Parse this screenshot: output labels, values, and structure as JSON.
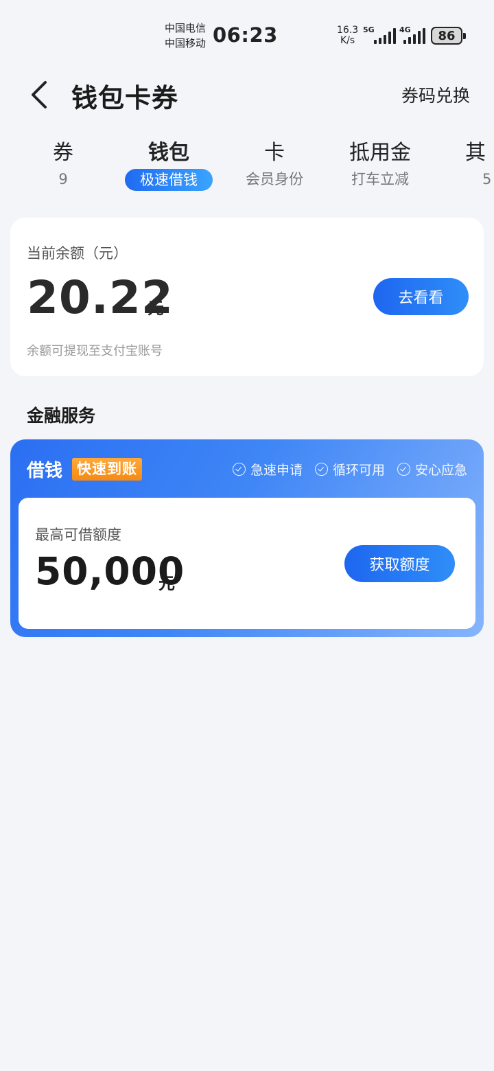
{
  "status_bar": {
    "carrier1": "中国电信",
    "carrier2": "中国移动",
    "time": "06:23",
    "net_speed_value": "16.3",
    "net_speed_unit": "K/s",
    "sim1_network": "5G",
    "sim2_network": "4G",
    "battery": "86"
  },
  "header": {
    "title": "钱包卡券",
    "action": "券码兑换"
  },
  "tabs": [
    {
      "title": "券",
      "sub": "9"
    },
    {
      "title": "钱包",
      "sub": "极速借钱"
    },
    {
      "title": "卡",
      "sub": "会员身份"
    },
    {
      "title": "抵用金",
      "sub": "打车立减"
    },
    {
      "title": "其",
      "sub": "5"
    }
  ],
  "balance": {
    "label": "当前余额（元）",
    "amount": "20.22",
    "unit": "元",
    "button": "去看看",
    "note": "余额可提现至支付宝账号"
  },
  "finance_section_title": "金融服务",
  "loan": {
    "title": "借钱",
    "badge": "快速到账",
    "features": [
      "急速申请",
      "循环可用",
      "安心应急"
    ],
    "limit_label": "最高可借额度",
    "limit_amount": "50,000",
    "limit_unit": "元",
    "button": "获取额度"
  },
  "colors": {
    "accent": "#1e66f0",
    "badge_orange": "#f58a14",
    "background": "#f4f5f9"
  }
}
